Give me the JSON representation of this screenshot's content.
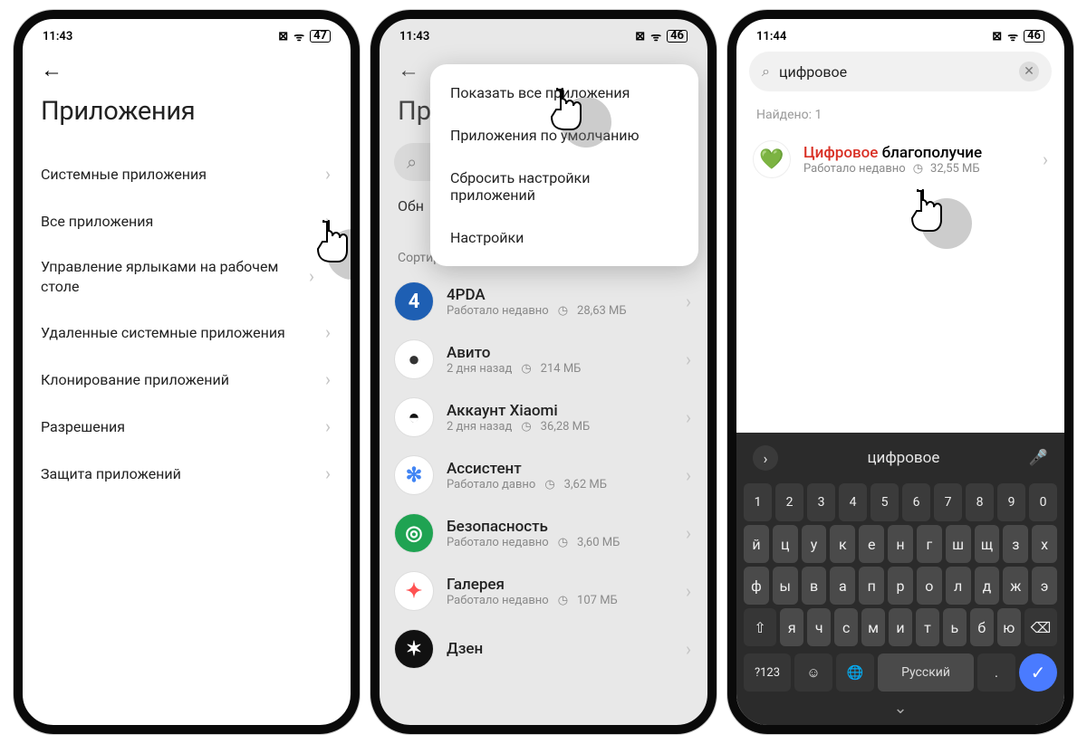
{
  "status": {
    "time1": "11:43",
    "time2": "11:43",
    "time3": "11:44",
    "batt1": "47",
    "batt2": "46",
    "batt3": "46"
  },
  "p1": {
    "title": "Приложения",
    "items": [
      "Системные приложения",
      "Все приложения",
      "Управление ярлыками на рабочем столе",
      "Удаленные системные приложения",
      "Клонирование приложений",
      "Разрешения",
      "Защита приложений"
    ]
  },
  "p2": {
    "title": "Пр",
    "update_label": "Обн",
    "sort_label": "Сортировка по имени приложения",
    "popup": [
      "Показать все приложения",
      "Приложения по умолчанию",
      "Сбросить настройки приложений",
      "Настройки"
    ],
    "apps": [
      {
        "name": "4PDA",
        "sub": "Работало недавно",
        "size": "28,63 МБ",
        "bg": "#1e5fb3",
        "fg": "#fff",
        "glyph": "4"
      },
      {
        "name": "Авито",
        "sub": "2 дня назад",
        "size": "214 МБ",
        "bg": "#fff",
        "fg": "#333",
        "glyph": "●"
      },
      {
        "name": "Аккаунт Xiaomi",
        "sub": "2 дня назад",
        "size": "36,28 МБ",
        "bg": "#fff",
        "fg": "#111",
        "glyph": "◓"
      },
      {
        "name": "Ассистент",
        "sub": "Работало давно",
        "size": "3,62 МБ",
        "bg": "#fff",
        "fg": "#4285f4",
        "glyph": "✻"
      },
      {
        "name": "Безопасность",
        "sub": "Работало недавно",
        "size": "3,60 МБ",
        "bg": "#1fa352",
        "fg": "#fff",
        "glyph": "◎"
      },
      {
        "name": "Галерея",
        "sub": "Работало недавно",
        "size": "107 МБ",
        "bg": "#fff",
        "fg": "#ff5252",
        "glyph": "✦"
      },
      {
        "name": "Дзен",
        "sub": "",
        "size": "",
        "bg": "#111",
        "fg": "#fff",
        "glyph": "✶"
      }
    ]
  },
  "p3": {
    "search_value": "цифровое",
    "found_label": "Найдено: 1",
    "result": {
      "highlight": "Цифровое",
      "rest": " благополучие",
      "sub": "Работало недавно",
      "size": "32,55 МБ"
    },
    "kb": {
      "suggestion": "цифровое",
      "nums": [
        "1",
        "2",
        "3",
        "4",
        "5",
        "6",
        "7",
        "8",
        "9",
        "0"
      ],
      "row1": [
        "й",
        "ц",
        "у",
        "к",
        "е",
        "н",
        "г",
        "ш",
        "щ",
        "з",
        "х"
      ],
      "row2": [
        "ф",
        "ы",
        "в",
        "а",
        "п",
        "р",
        "о",
        "л",
        "д",
        "ж",
        "э"
      ],
      "row3": [
        "я",
        "ч",
        "с",
        "м",
        "и",
        "т",
        "ь",
        "б",
        "ю"
      ],
      "space": "Русский",
      "sym": "?123"
    }
  }
}
